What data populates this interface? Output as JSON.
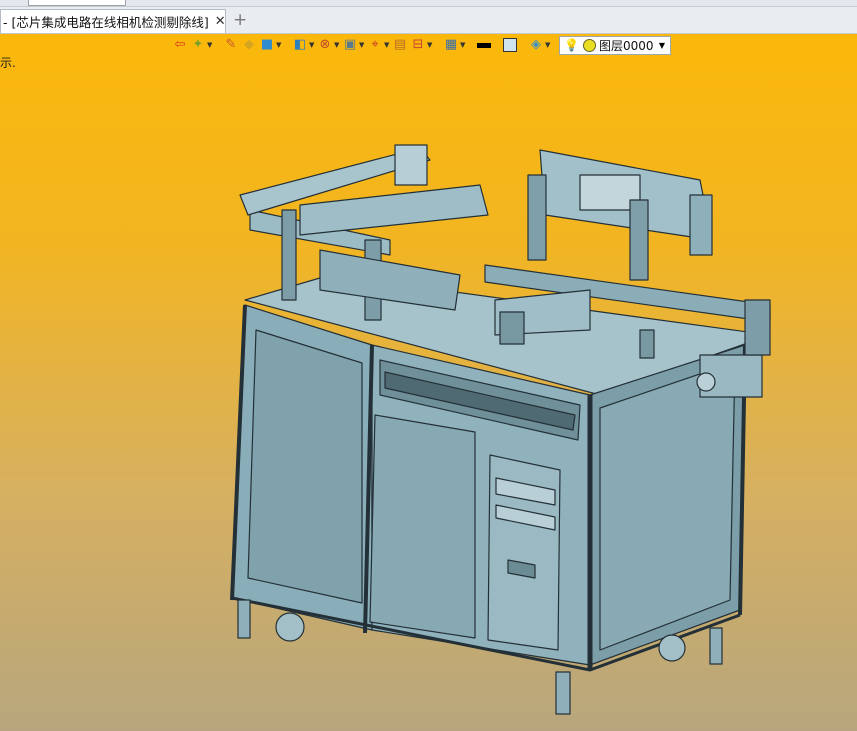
{
  "document_tab": {
    "title": "- [芯片集成电路在线相机检测剔除线]",
    "close_glyph": "✕"
  },
  "new_tab_glyph": "+",
  "viewport": {
    "hint_text": "示."
  },
  "view_toolbar": {
    "icons": [
      "exit-icon",
      "light-icon",
      "pen-icon",
      "box-icon",
      "cube-icon",
      "view-orient-icon",
      "render-icon",
      "wireframe-icon",
      "target-icon",
      "section-icon",
      "dimension-icon",
      "display-icon",
      "color-swatch-black",
      "color-swatch-light",
      "surface-icon"
    ],
    "layer": {
      "label": "图层0000"
    }
  },
  "colors": {
    "background_top": "#fbb80a",
    "background_bottom": "#b7a67d",
    "model_fill": "#8eb4bf",
    "model_stroke": "#243037"
  }
}
